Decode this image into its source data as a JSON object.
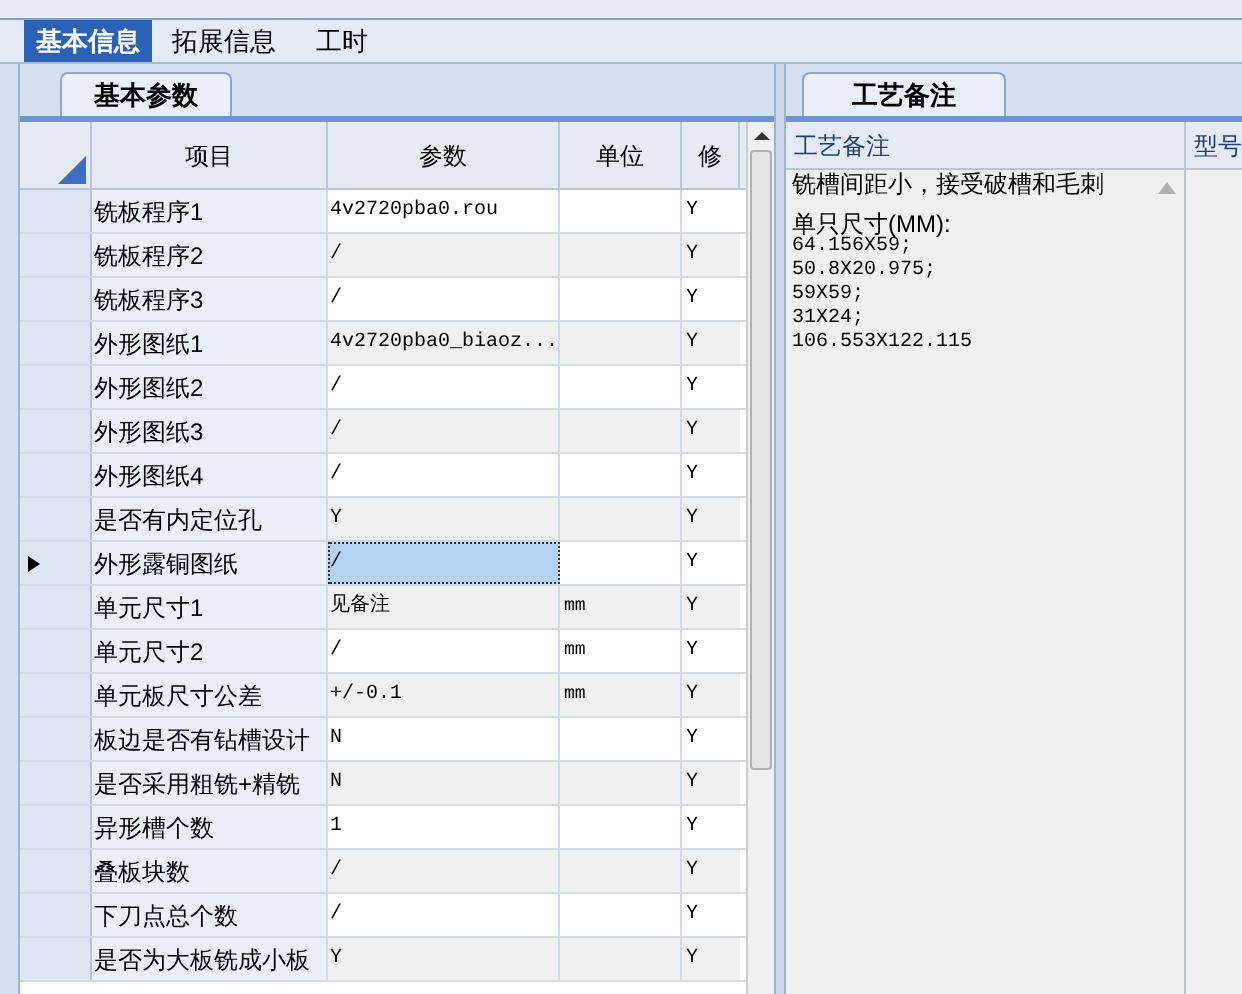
{
  "tabs": [
    {
      "label": "基本信息",
      "selected": true
    },
    {
      "label": "拓展信息",
      "selected": false
    },
    {
      "label": "工时",
      "selected": false
    }
  ],
  "params_panel": {
    "tab": "基本参数",
    "columns": [
      "项目",
      "参数",
      "单位",
      "修"
    ],
    "rows": [
      {
        "item": "铣板程序1",
        "value": "4v2720pba0.rou",
        "unit": "",
        "flag": "Y",
        "selected": false
      },
      {
        "item": "铣板程序2",
        "value": "/",
        "unit": "",
        "flag": "Y",
        "selected": false
      },
      {
        "item": "铣板程序3",
        "value": "/",
        "unit": "",
        "flag": "Y",
        "selected": false
      },
      {
        "item": "外形图纸1",
        "value": "4v2720pba0_biaoz...",
        "unit": "",
        "flag": "Y",
        "selected": false
      },
      {
        "item": "外形图纸2",
        "value": "/",
        "unit": "",
        "flag": "Y",
        "selected": false
      },
      {
        "item": "外形图纸3",
        "value": "/",
        "unit": "",
        "flag": "Y",
        "selected": false
      },
      {
        "item": "外形图纸4",
        "value": "/",
        "unit": "",
        "flag": "Y",
        "selected": false
      },
      {
        "item": "是否有内定位孔",
        "value": "Y",
        "unit": "",
        "flag": "Y",
        "selected": false
      },
      {
        "item": "外形露铜图纸",
        "value": "/",
        "unit": "",
        "flag": "Y",
        "selected": true
      },
      {
        "item": "单元尺寸1",
        "value": "见备注",
        "unit": "mm",
        "flag": "Y",
        "selected": false
      },
      {
        "item": "单元尺寸2",
        "value": "/",
        "unit": "mm",
        "flag": "Y",
        "selected": false
      },
      {
        "item": "单元板尺寸公差",
        "value": "+/-0.1",
        "unit": "mm",
        "flag": "Y",
        "selected": false
      },
      {
        "item": "板边是否有钻槽设计",
        "value": "N",
        "unit": "",
        "flag": "Y",
        "selected": false
      },
      {
        "item": "是否采用粗铣+精铣",
        "value": "N",
        "unit": "",
        "flag": "Y",
        "selected": false
      },
      {
        "item": "异形槽个数",
        "value": "1",
        "unit": "",
        "flag": "Y",
        "selected": false
      },
      {
        "item": "叠板块数",
        "value": "/",
        "unit": "",
        "flag": "Y",
        "selected": false
      },
      {
        "item": "下刀点总个数",
        "value": "/",
        "unit": "",
        "flag": "Y",
        "selected": false
      },
      {
        "item": "是否为大板铣成小板",
        "value": "Y",
        "unit": "",
        "flag": "Y",
        "selected": false
      }
    ]
  },
  "notes_panel": {
    "tab": "工艺备注",
    "columns": [
      "工艺备注",
      "型号"
    ],
    "note_paragraphs": [
      [
        "铣槽间距小，接受破槽和毛刺"
      ],
      [
        "单只尺寸(MM):",
        "64.156X59;",
        "50.8X20.975;",
        "59X59;",
        "31X24;",
        "106.553X122.115"
      ]
    ]
  }
}
